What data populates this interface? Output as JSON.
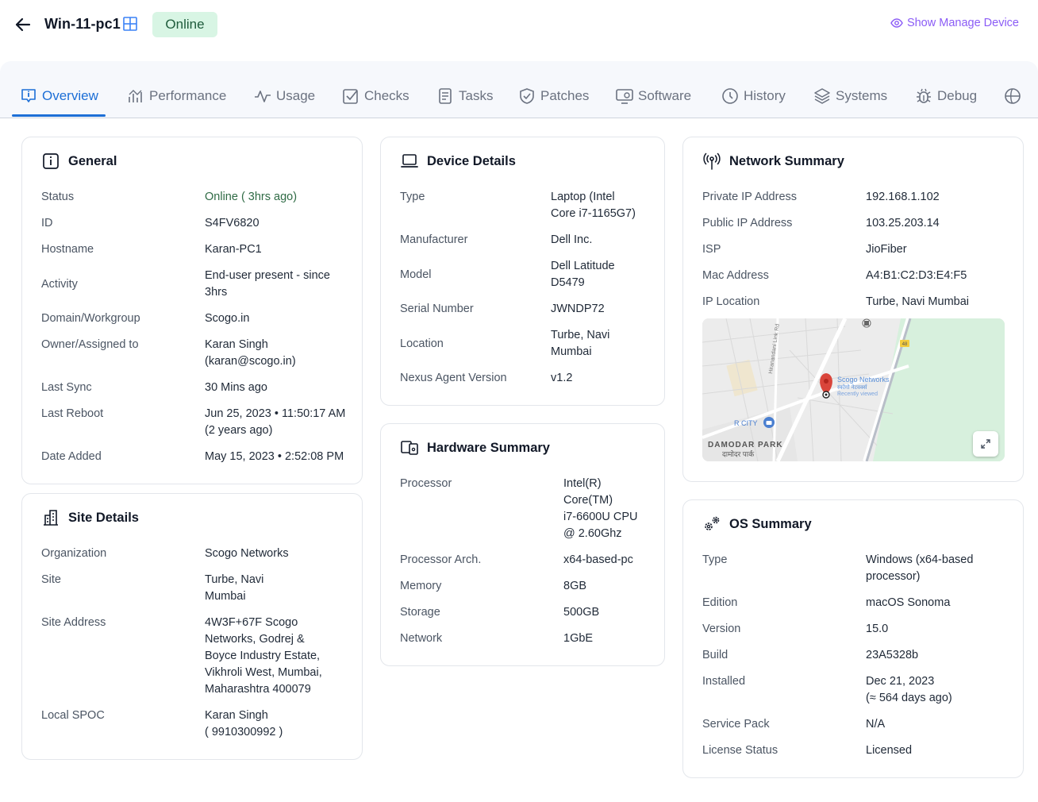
{
  "header": {
    "device_name": "Win-11-pc1",
    "status": "Online",
    "manage_link": "Show Manage Device"
  },
  "tabs": [
    {
      "label": "Overview",
      "icon": "info-chat-icon",
      "active": true
    },
    {
      "label": "Performance",
      "icon": "performance-icon"
    },
    {
      "label": "Usage",
      "icon": "pulse-icon"
    },
    {
      "label": "Checks",
      "icon": "checkbox-icon"
    },
    {
      "label": "Tasks",
      "icon": "clipboard-icon"
    },
    {
      "label": "Patches",
      "icon": "shield-check-icon"
    },
    {
      "label": "Software",
      "icon": "monitor-gear-icon"
    },
    {
      "label": "History",
      "icon": "clock-icon"
    },
    {
      "label": "Systems",
      "icon": "layers-icon"
    },
    {
      "label": "Debug",
      "icon": "bug-icon"
    }
  ],
  "general": {
    "title": "General",
    "rows": [
      {
        "label": "Status",
        "value": "Online ( 3hrs ago)"
      },
      {
        "label": "ID",
        "value": "S4FV6820"
      },
      {
        "label": "Hostname",
        "value": "Karan-PC1"
      },
      {
        "label": "Activity",
        "value": "End-user present - since",
        "value2": "3hrs"
      },
      {
        "label": "Domain/Workgroup",
        "value": "Scogo.in"
      },
      {
        "label": "Owner/Assigned to",
        "value": "Karan Singh",
        "value2": "(karan@scogo.in)"
      },
      {
        "label": "Last Sync",
        "value": "30 Mins ago"
      },
      {
        "label": "Last Reboot",
        "value": "Jun 25, 2023 • 11:50:17 AM",
        "value2": "(2 years ago)"
      },
      {
        "label": "Date Added",
        "value": "May 15, 2023 • 2:52:08 PM"
      }
    ]
  },
  "site": {
    "title": "Site Details",
    "rows": [
      {
        "label": "Organization",
        "value": "Scogo Networks"
      },
      {
        "label": "Site",
        "value": "Turbe, Navi",
        "value2": "Mumbai"
      },
      {
        "label": "Site Address",
        "lines": [
          "4W3F+67F Scogo",
          "Networks, Godrej &",
          "Boyce Industry Estate,",
          "Vikhroli West, Mumbai,",
          "Maharashtra 400079"
        ]
      },
      {
        "label": "Local SPOC",
        "value": "Karan Singh",
        "value2": "( 9910300992 )"
      }
    ]
  },
  "device": {
    "title": "Device Details",
    "rows": [
      {
        "label": "Type",
        "value": "Laptop (Intel",
        "value2": "Core i7-1165G7)"
      },
      {
        "label": "Manufacturer",
        "value": "Dell Inc."
      },
      {
        "label": "Model",
        "value": "Dell Latitude",
        "value2": "D5479"
      },
      {
        "label": "Serial Number",
        "value": "JWNDP72"
      },
      {
        "label": "Location",
        "value": "Turbe, Navi",
        "value2": "Mumbai"
      },
      {
        "label": "Nexus Agent Version",
        "value": "v1.2"
      }
    ]
  },
  "hardware": {
    "title": "Hardware Summary",
    "rows": [
      {
        "label": "Processor",
        "lines": [
          "Intel(R)",
          "Core(TM)",
          "i7-6600U CPU",
          "@ 2.60Ghz"
        ]
      },
      {
        "label": "Processor Arch.",
        "value": "x64-based-pc"
      },
      {
        "label": "Memory",
        "value": "8GB"
      },
      {
        "label": "Storage",
        "value": "500GB"
      },
      {
        "label": "Network",
        "value": "1GbE"
      }
    ]
  },
  "network": {
    "title": "Network Summary",
    "rows": [
      {
        "label": "Private IP Address",
        "value": "192.168.1.102"
      },
      {
        "label": "Public IP Address",
        "value": "103.25.203.14"
      },
      {
        "label": "ISP",
        "value": "JioFiber"
      },
      {
        "label": "Mac Address",
        "value": "A4:B1:C2:D3:E4:F5"
      },
      {
        "label": "IP Location",
        "value": "Turbe, Navi Mumbai"
      }
    ],
    "map": {
      "place_label": "Scogo Networks",
      "place_label_local": "स्कोगो नेटवर्क्स",
      "place_sub": "Recently viewed",
      "road_label": "Hiranandani Link Rd",
      "mall_label": "R CITY",
      "area_label": "DAMODAR PARK",
      "area_label_local": "दामोदर पार्क",
      "highway_badge": "48"
    }
  },
  "os": {
    "title": "OS Summary",
    "rows": [
      {
        "label": "Type",
        "value": "Windows (x64-based",
        "value2": "processor)"
      },
      {
        "label": "Edition",
        "value": "macOS Sonoma"
      },
      {
        "label": "Version",
        "value": "15.0"
      },
      {
        "label": "Build",
        "value": "23A5328b"
      },
      {
        "label": "Installed",
        "value": "Dec 21, 2023",
        "value2": "(≈ 564 days ago)"
      },
      {
        "label": "Service Pack",
        "value": "N/A"
      },
      {
        "label": "License Status",
        "value": "Licensed"
      }
    ]
  },
  "colors": {
    "accent": "#1d6fd6",
    "manage_link": "#8b5cf6",
    "online_bg": "#d8f5e4",
    "online_text": "#2f6b45"
  }
}
